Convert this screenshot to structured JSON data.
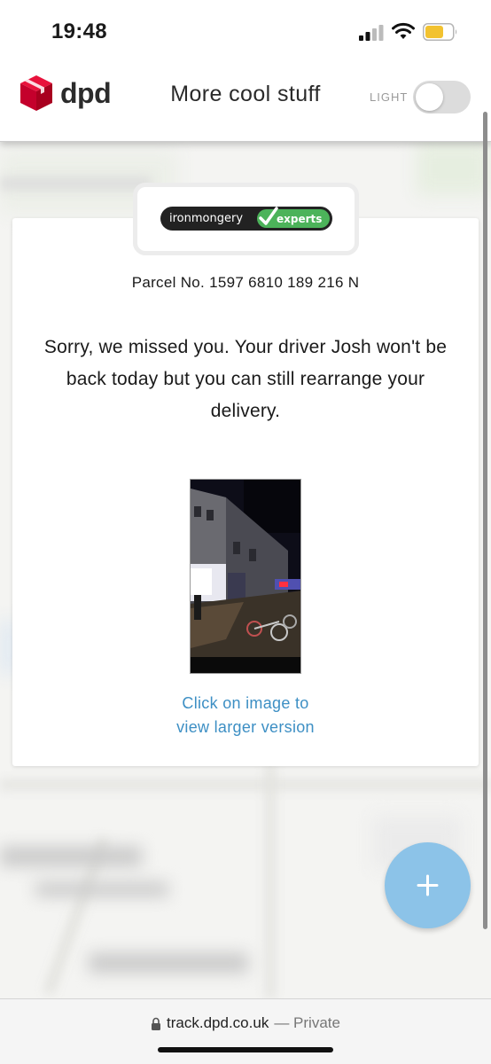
{
  "status_bar": {
    "time": "19:48",
    "icons": [
      "signal-icon",
      "wifi-icon",
      "battery-icon"
    ],
    "battery_color": "#f2c230"
  },
  "header": {
    "brand": "dpd",
    "brand_color": "#dc0032",
    "title": "More cool stuff",
    "theme_toggle_label": "LIGHT"
  },
  "card": {
    "retailer": {
      "name_part1": "ironmongery",
      "name_part2": "experts",
      "accent_color": "#4cb35a"
    },
    "parcel_number": "Parcel No. 1597 6810 189 216 N",
    "message": "Sorry, we missed you. Your driver Josh won't be back today but you can still rearrange your delivery.",
    "image_link_line1": "Click on image to",
    "image_link_line2": "view larger version",
    "link_color": "#3d8fc4"
  },
  "fab": {
    "icon": "plus-icon",
    "color": "#8cc3e8"
  },
  "url_bar": {
    "domain": "track.dpd.co.uk",
    "private_label": "— Private"
  }
}
